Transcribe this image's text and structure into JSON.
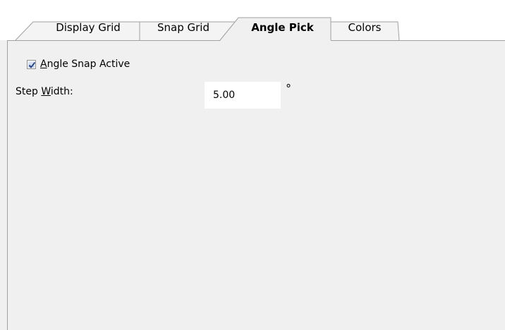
{
  "tabs": [
    {
      "label": "Display Grid",
      "active": false
    },
    {
      "label": "Snap Grid",
      "active": false
    },
    {
      "label": "Angle Pick",
      "active": true
    },
    {
      "label": "Colors",
      "active": false
    }
  ],
  "angle_pick": {
    "angle_snap_checkbox": {
      "checked": true,
      "label_accel": "A",
      "label_rest": "ngle Snap Active"
    },
    "step_width": {
      "label_pre": "Step ",
      "label_accel": "W",
      "label_post": "idth:",
      "value": "5.00",
      "unit": "°"
    }
  }
}
